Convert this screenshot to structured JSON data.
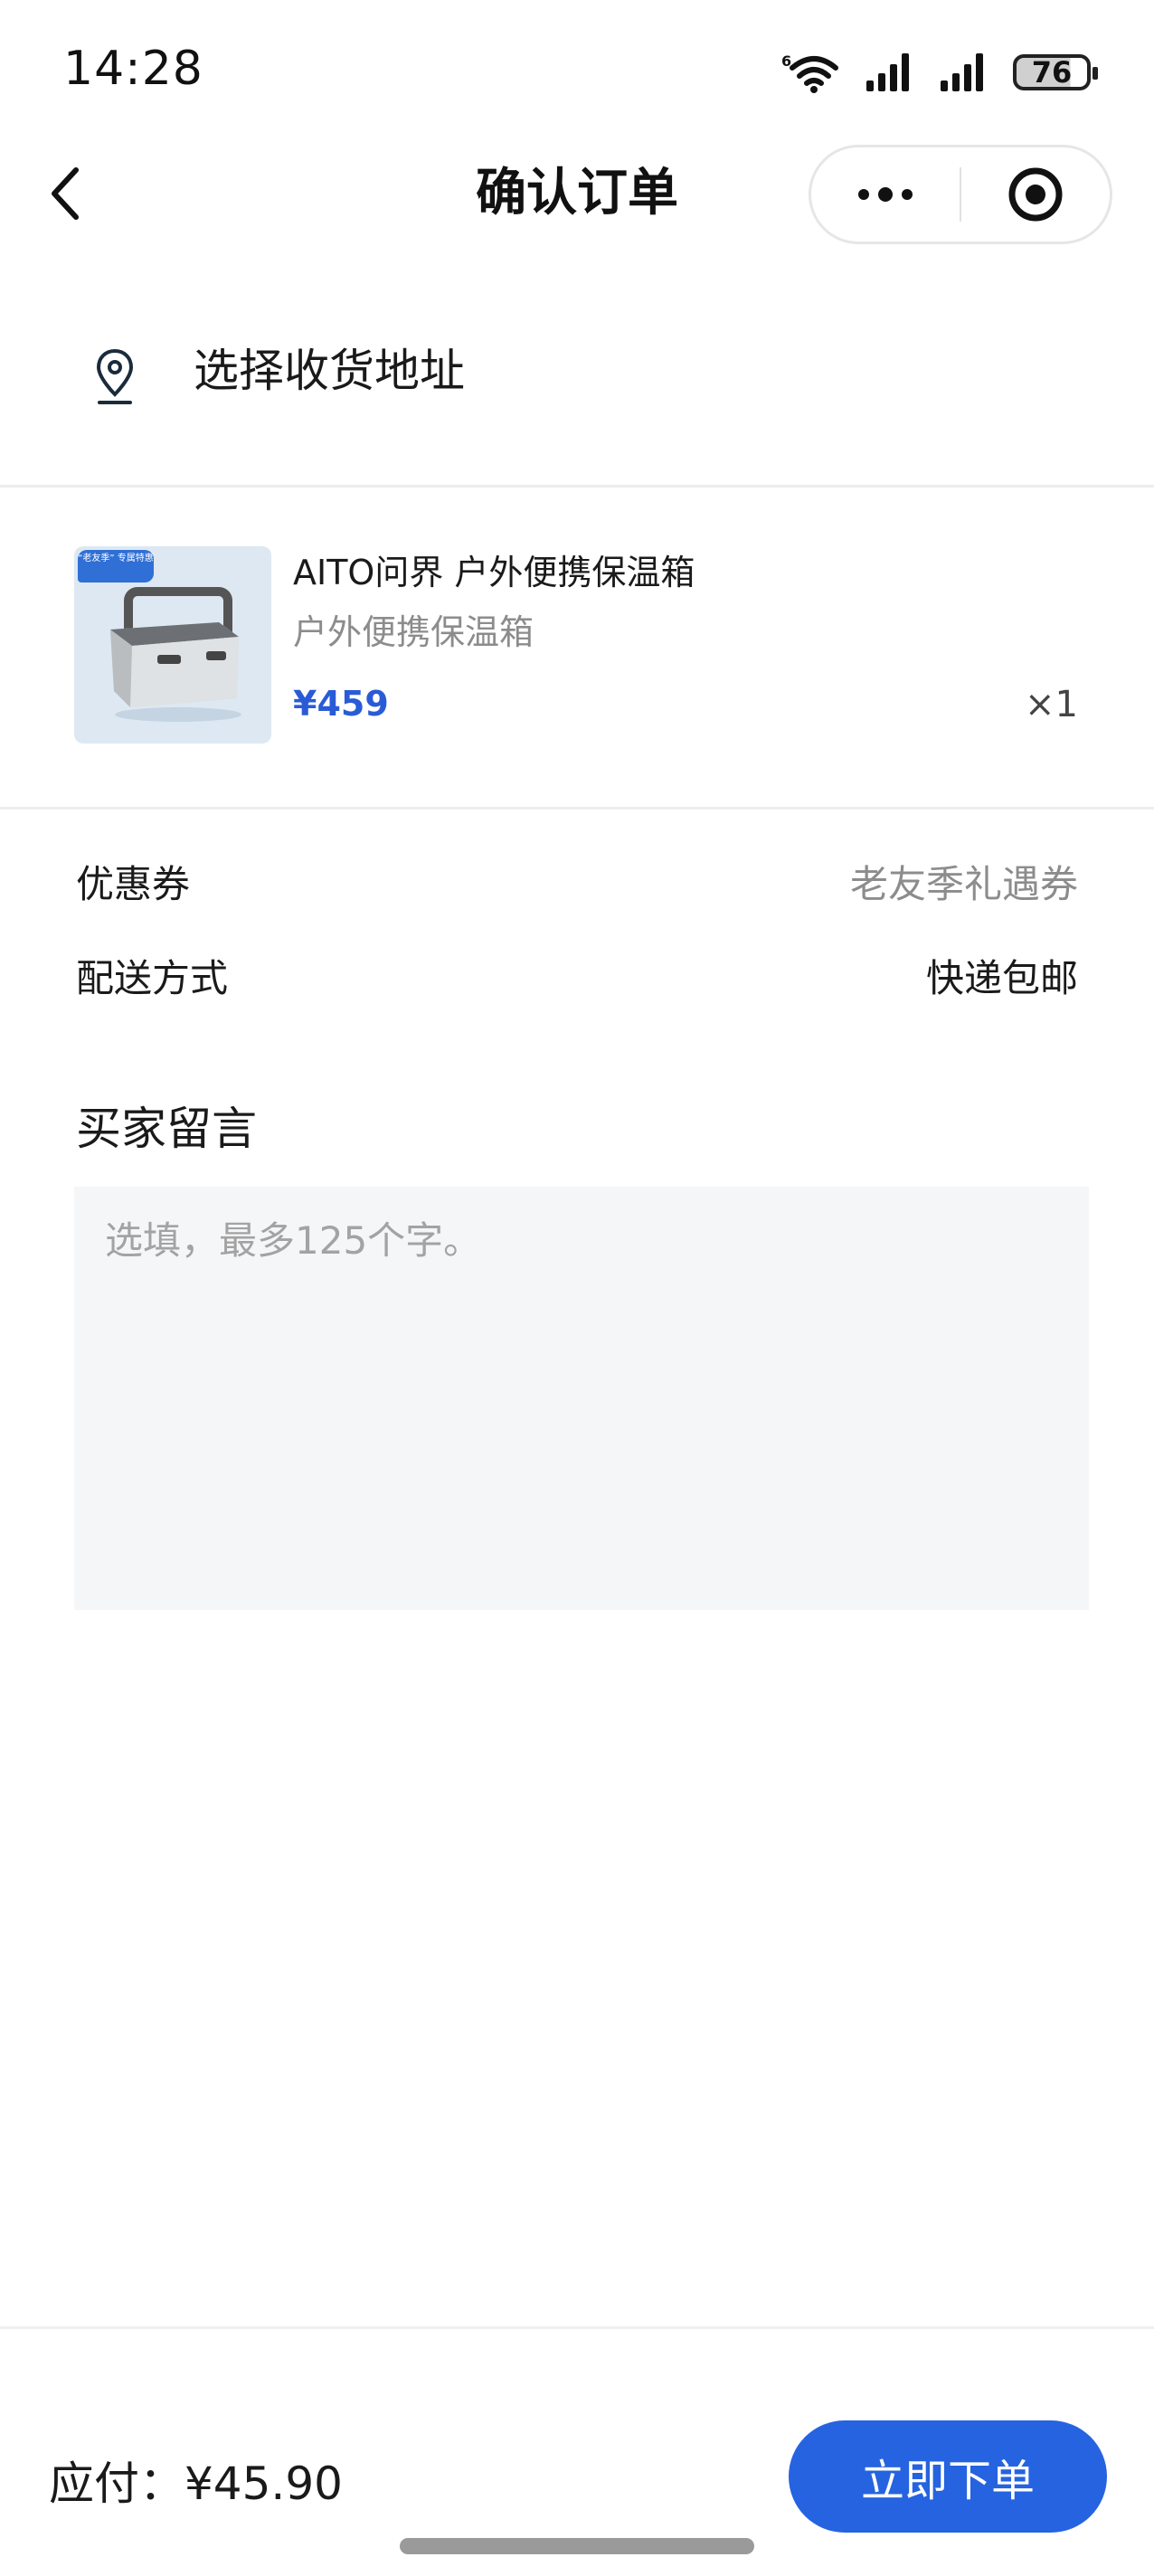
{
  "status_bar": {
    "time": "14:28",
    "battery": "76",
    "battery_level": 0.76,
    "icons": [
      "wifi-icon",
      "signal-icon",
      "signal-icon",
      "battery-icon"
    ]
  },
  "nav": {
    "title": "确认订单",
    "icons": [
      "back-arrow-icon",
      "more-dots-icon",
      "target-icon"
    ]
  },
  "address": {
    "label": "选择收货地址",
    "icon": "location-pin-icon"
  },
  "product": {
    "thumb_tag": "“老友季” 专属特惠",
    "name": "AITO问界 户外便携保温箱",
    "spec": "户外便携保温箱",
    "price": "¥459",
    "quantity": "×1"
  },
  "options": {
    "coupon_label": "优惠券",
    "coupon_value": "老友季礼遇券",
    "delivery_label": "配送方式",
    "delivery_value": "快递包邮"
  },
  "memo": {
    "title": "买家留言",
    "placeholder": "选填，最多125个字。"
  },
  "footer": {
    "pay_label": "应付：¥45.90",
    "submit_label": "立即下单"
  },
  "colors": {
    "accent": "#2563e0",
    "price": "#2a5bd7",
    "muted": "#8c8c8c"
  }
}
